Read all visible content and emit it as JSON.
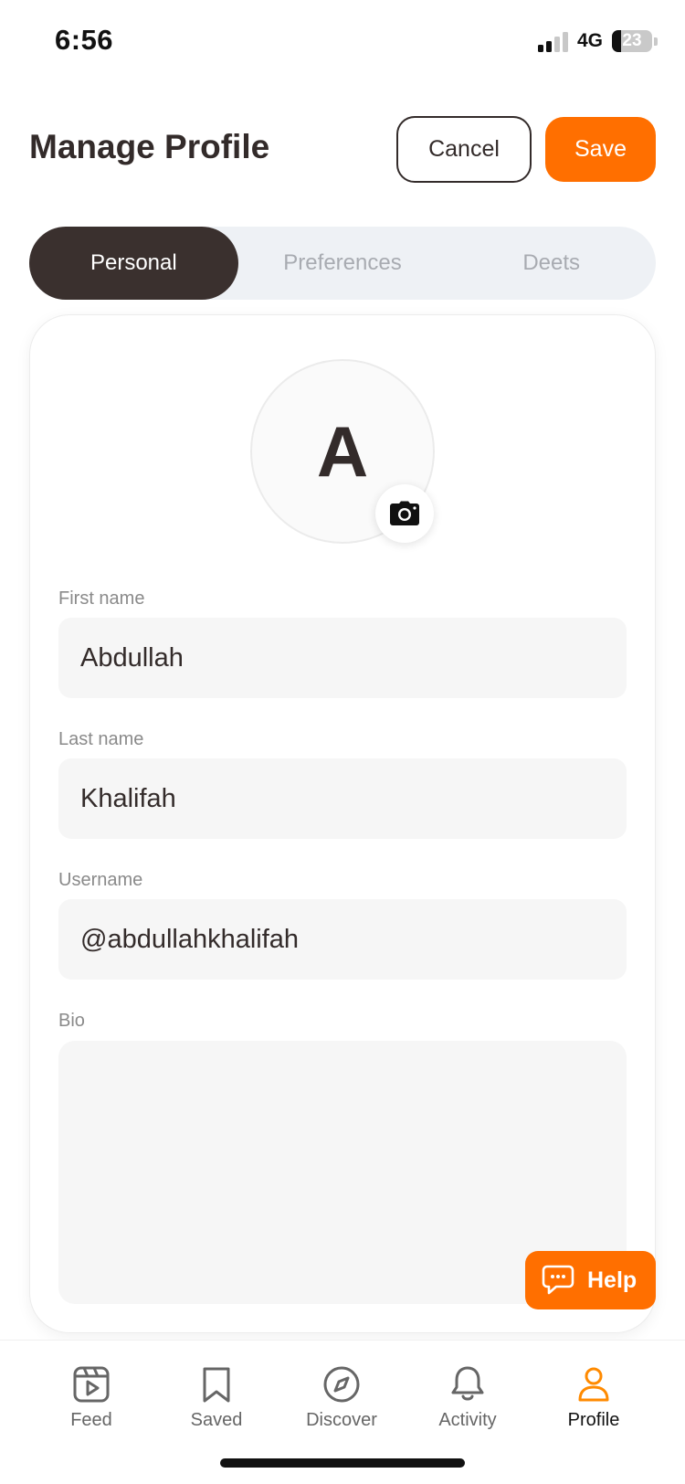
{
  "status_bar": {
    "time": "6:56",
    "network": "4G",
    "battery": "23",
    "battery_level": 0.23,
    "signal_bars_active": 2
  },
  "header": {
    "title": "Manage Profile",
    "cancel_label": "Cancel",
    "save_label": "Save"
  },
  "tabs": [
    {
      "label": "Personal",
      "active": true
    },
    {
      "label": "Preferences",
      "active": false
    },
    {
      "label": "Deets",
      "active": false
    }
  ],
  "profile": {
    "avatar_initial": "A"
  },
  "form": {
    "first_name": {
      "label": "First name",
      "value": "Abdullah"
    },
    "last_name": {
      "label": "Last name",
      "value": "Khalifah"
    },
    "username": {
      "label": "Username",
      "value": "@abdullahkhalifah"
    },
    "bio": {
      "label": "Bio",
      "value": ""
    }
  },
  "help": {
    "label": "Help"
  },
  "bottom_nav": [
    {
      "label": "Feed",
      "icon": "feed-icon",
      "active": false
    },
    {
      "label": "Saved",
      "icon": "bookmark-icon",
      "active": false
    },
    {
      "label": "Discover",
      "icon": "compass-icon",
      "active": false
    },
    {
      "label": "Activity",
      "icon": "bell-icon",
      "active": false
    },
    {
      "label": "Profile",
      "icon": "user-icon",
      "active": true
    }
  ],
  "colors": {
    "accent": "#ff6f00",
    "dark": "#332b2a",
    "tab_active_bg": "#3a302e",
    "input_bg": "#f6f6f6"
  }
}
